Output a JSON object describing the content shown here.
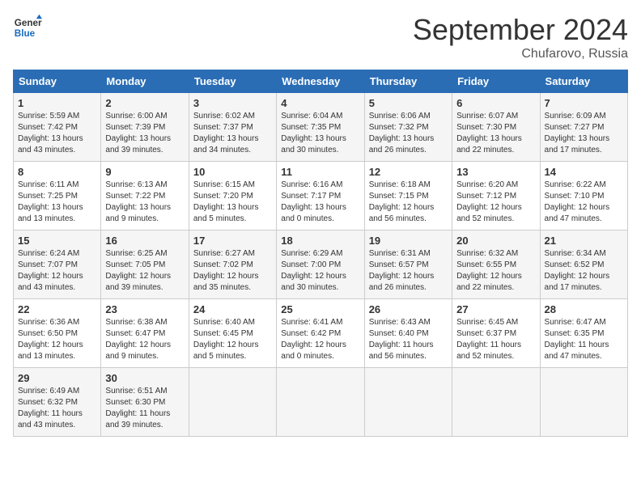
{
  "header": {
    "logo_line1": "General",
    "logo_line2": "Blue",
    "month_title": "September 2024",
    "subtitle": "Chufarovo, Russia"
  },
  "weekdays": [
    "Sunday",
    "Monday",
    "Tuesday",
    "Wednesday",
    "Thursday",
    "Friday",
    "Saturday"
  ],
  "weeks": [
    [
      {
        "day": "1",
        "info": "Sunrise: 5:59 AM\nSunset: 7:42 PM\nDaylight: 13 hours\nand 43 minutes."
      },
      {
        "day": "2",
        "info": "Sunrise: 6:00 AM\nSunset: 7:39 PM\nDaylight: 13 hours\nand 39 minutes."
      },
      {
        "day": "3",
        "info": "Sunrise: 6:02 AM\nSunset: 7:37 PM\nDaylight: 13 hours\nand 34 minutes."
      },
      {
        "day": "4",
        "info": "Sunrise: 6:04 AM\nSunset: 7:35 PM\nDaylight: 13 hours\nand 30 minutes."
      },
      {
        "day": "5",
        "info": "Sunrise: 6:06 AM\nSunset: 7:32 PM\nDaylight: 13 hours\nand 26 minutes."
      },
      {
        "day": "6",
        "info": "Sunrise: 6:07 AM\nSunset: 7:30 PM\nDaylight: 13 hours\nand 22 minutes."
      },
      {
        "day": "7",
        "info": "Sunrise: 6:09 AM\nSunset: 7:27 PM\nDaylight: 13 hours\nand 17 minutes."
      }
    ],
    [
      {
        "day": "8",
        "info": "Sunrise: 6:11 AM\nSunset: 7:25 PM\nDaylight: 13 hours\nand 13 minutes."
      },
      {
        "day": "9",
        "info": "Sunrise: 6:13 AM\nSunset: 7:22 PM\nDaylight: 13 hours\nand 9 minutes."
      },
      {
        "day": "10",
        "info": "Sunrise: 6:15 AM\nSunset: 7:20 PM\nDaylight: 13 hours\nand 5 minutes."
      },
      {
        "day": "11",
        "info": "Sunrise: 6:16 AM\nSunset: 7:17 PM\nDaylight: 13 hours\nand 0 minutes."
      },
      {
        "day": "12",
        "info": "Sunrise: 6:18 AM\nSunset: 7:15 PM\nDaylight: 12 hours\nand 56 minutes."
      },
      {
        "day": "13",
        "info": "Sunrise: 6:20 AM\nSunset: 7:12 PM\nDaylight: 12 hours\nand 52 minutes."
      },
      {
        "day": "14",
        "info": "Sunrise: 6:22 AM\nSunset: 7:10 PM\nDaylight: 12 hours\nand 47 minutes."
      }
    ],
    [
      {
        "day": "15",
        "info": "Sunrise: 6:24 AM\nSunset: 7:07 PM\nDaylight: 12 hours\nand 43 minutes."
      },
      {
        "day": "16",
        "info": "Sunrise: 6:25 AM\nSunset: 7:05 PM\nDaylight: 12 hours\nand 39 minutes."
      },
      {
        "day": "17",
        "info": "Sunrise: 6:27 AM\nSunset: 7:02 PM\nDaylight: 12 hours\nand 35 minutes."
      },
      {
        "day": "18",
        "info": "Sunrise: 6:29 AM\nSunset: 7:00 PM\nDaylight: 12 hours\nand 30 minutes."
      },
      {
        "day": "19",
        "info": "Sunrise: 6:31 AM\nSunset: 6:57 PM\nDaylight: 12 hours\nand 26 minutes."
      },
      {
        "day": "20",
        "info": "Sunrise: 6:32 AM\nSunset: 6:55 PM\nDaylight: 12 hours\nand 22 minutes."
      },
      {
        "day": "21",
        "info": "Sunrise: 6:34 AM\nSunset: 6:52 PM\nDaylight: 12 hours\nand 17 minutes."
      }
    ],
    [
      {
        "day": "22",
        "info": "Sunrise: 6:36 AM\nSunset: 6:50 PM\nDaylight: 12 hours\nand 13 minutes."
      },
      {
        "day": "23",
        "info": "Sunrise: 6:38 AM\nSunset: 6:47 PM\nDaylight: 12 hours\nand 9 minutes."
      },
      {
        "day": "24",
        "info": "Sunrise: 6:40 AM\nSunset: 6:45 PM\nDaylight: 12 hours\nand 5 minutes."
      },
      {
        "day": "25",
        "info": "Sunrise: 6:41 AM\nSunset: 6:42 PM\nDaylight: 12 hours\nand 0 minutes."
      },
      {
        "day": "26",
        "info": "Sunrise: 6:43 AM\nSunset: 6:40 PM\nDaylight: 11 hours\nand 56 minutes."
      },
      {
        "day": "27",
        "info": "Sunrise: 6:45 AM\nSunset: 6:37 PM\nDaylight: 11 hours\nand 52 minutes."
      },
      {
        "day": "28",
        "info": "Sunrise: 6:47 AM\nSunset: 6:35 PM\nDaylight: 11 hours\nand 47 minutes."
      }
    ],
    [
      {
        "day": "29",
        "info": "Sunrise: 6:49 AM\nSunset: 6:32 PM\nDaylight: 11 hours\nand 43 minutes."
      },
      {
        "day": "30",
        "info": "Sunrise: 6:51 AM\nSunset: 6:30 PM\nDaylight: 11 hours\nand 39 minutes."
      },
      {
        "day": "",
        "info": ""
      },
      {
        "day": "",
        "info": ""
      },
      {
        "day": "",
        "info": ""
      },
      {
        "day": "",
        "info": ""
      },
      {
        "day": "",
        "info": ""
      }
    ]
  ]
}
